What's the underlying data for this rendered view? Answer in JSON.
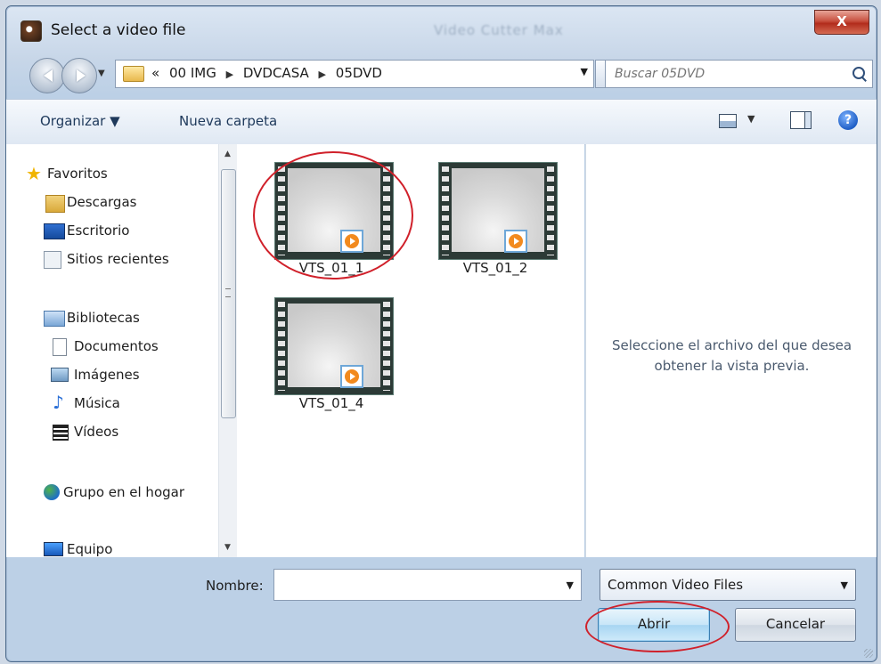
{
  "window": {
    "title": "Select a video file",
    "ghost_title": "Video Cutter Max",
    "close_label": "X"
  },
  "addressbar": {
    "crumbs": [
      "«",
      "00 IMG",
      "DVDCASA",
      "05DVD"
    ],
    "separator": "▶"
  },
  "search": {
    "placeholder": "Buscar 05DVD"
  },
  "toolbar": {
    "organize_label": "Organizar ▼",
    "new_folder_label": "Nueva carpeta",
    "help_label": "?"
  },
  "nav": {
    "items": [
      {
        "label": "Favoritos",
        "icon": "star-icon"
      },
      {
        "label": "Descargas",
        "icon": "downloads-folder-icon"
      },
      {
        "label": "Escritorio",
        "icon": "desktop-icon"
      },
      {
        "label": "Sitios recientes",
        "icon": "recent-places-icon"
      },
      {
        "label": "Bibliotecas",
        "icon": "libraries-icon"
      },
      {
        "label": "Documentos",
        "icon": "documents-icon"
      },
      {
        "label": "Imágenes",
        "icon": "pictures-icon"
      },
      {
        "label": "Música",
        "icon": "music-icon"
      },
      {
        "label": "Vídeos",
        "icon": "videos-icon"
      },
      {
        "label": "Grupo en el hogar",
        "icon": "homegroup-icon"
      },
      {
        "label": "Equipo",
        "icon": "computer-icon"
      }
    ]
  },
  "files": [
    {
      "name": "VTS_01_1",
      "annotated": true
    },
    {
      "name": "VTS_01_2",
      "annotated": false
    },
    {
      "name": "VTS_01_4",
      "annotated": false
    }
  ],
  "preview": {
    "line1": "Seleccione el archivo del que desea",
    "line2": "obtener la vista previa."
  },
  "footer": {
    "name_label": "Nombre:",
    "name_value": "",
    "type_value": "Common Video Files",
    "open_label": "Abrir",
    "cancel_label": "Cancelar"
  },
  "colors": {
    "annotation": "#d0202a",
    "accent": "#3c7fb1"
  }
}
